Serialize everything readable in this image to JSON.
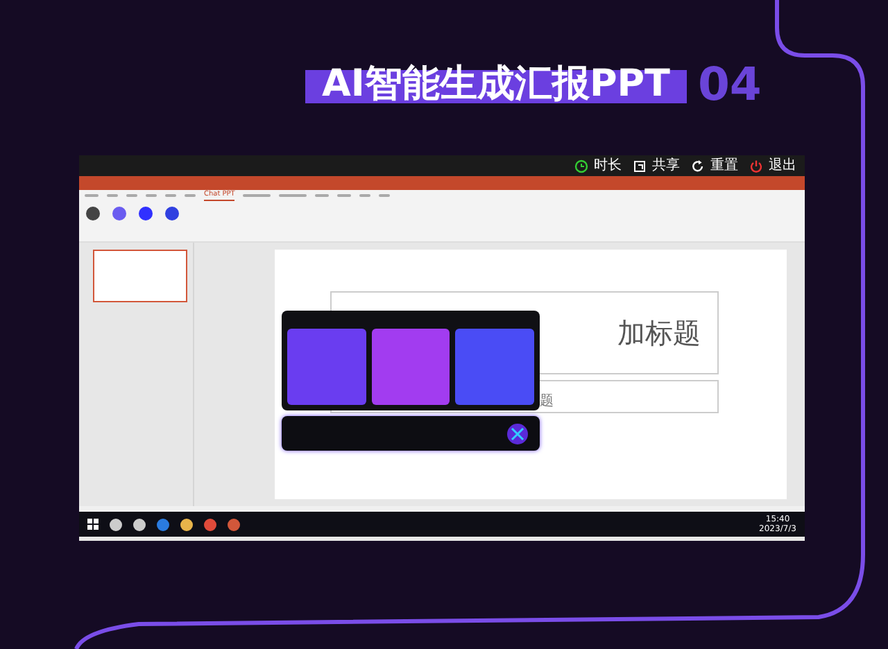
{
  "banner": {
    "title": "AI智能生成汇报PPT",
    "number": "04"
  },
  "recorder_bar": {
    "items": [
      {
        "kind": "clock",
        "label": "时长"
      },
      {
        "kind": "share",
        "label": "共享"
      },
      {
        "kind": "reset",
        "label": "重置"
      },
      {
        "kind": "power",
        "label": "退出"
      }
    ]
  },
  "ribbon": {
    "tabs": [
      {
        "label": "Chat PPT",
        "selected": true
      }
    ]
  },
  "slides": [
    {
      "selected": true
    }
  ],
  "slide": {
    "title_fragment": "加标题",
    "subtitle_fragment": "题"
  },
  "assistant_popup": {
    "cards": [
      {
        "color": "#6a3df0"
      },
      {
        "color": "#a23cf0"
      },
      {
        "color": "#4a4cf5"
      }
    ]
  },
  "taskbar": {
    "time": "15:40",
    "date": "2023/7/3"
  }
}
